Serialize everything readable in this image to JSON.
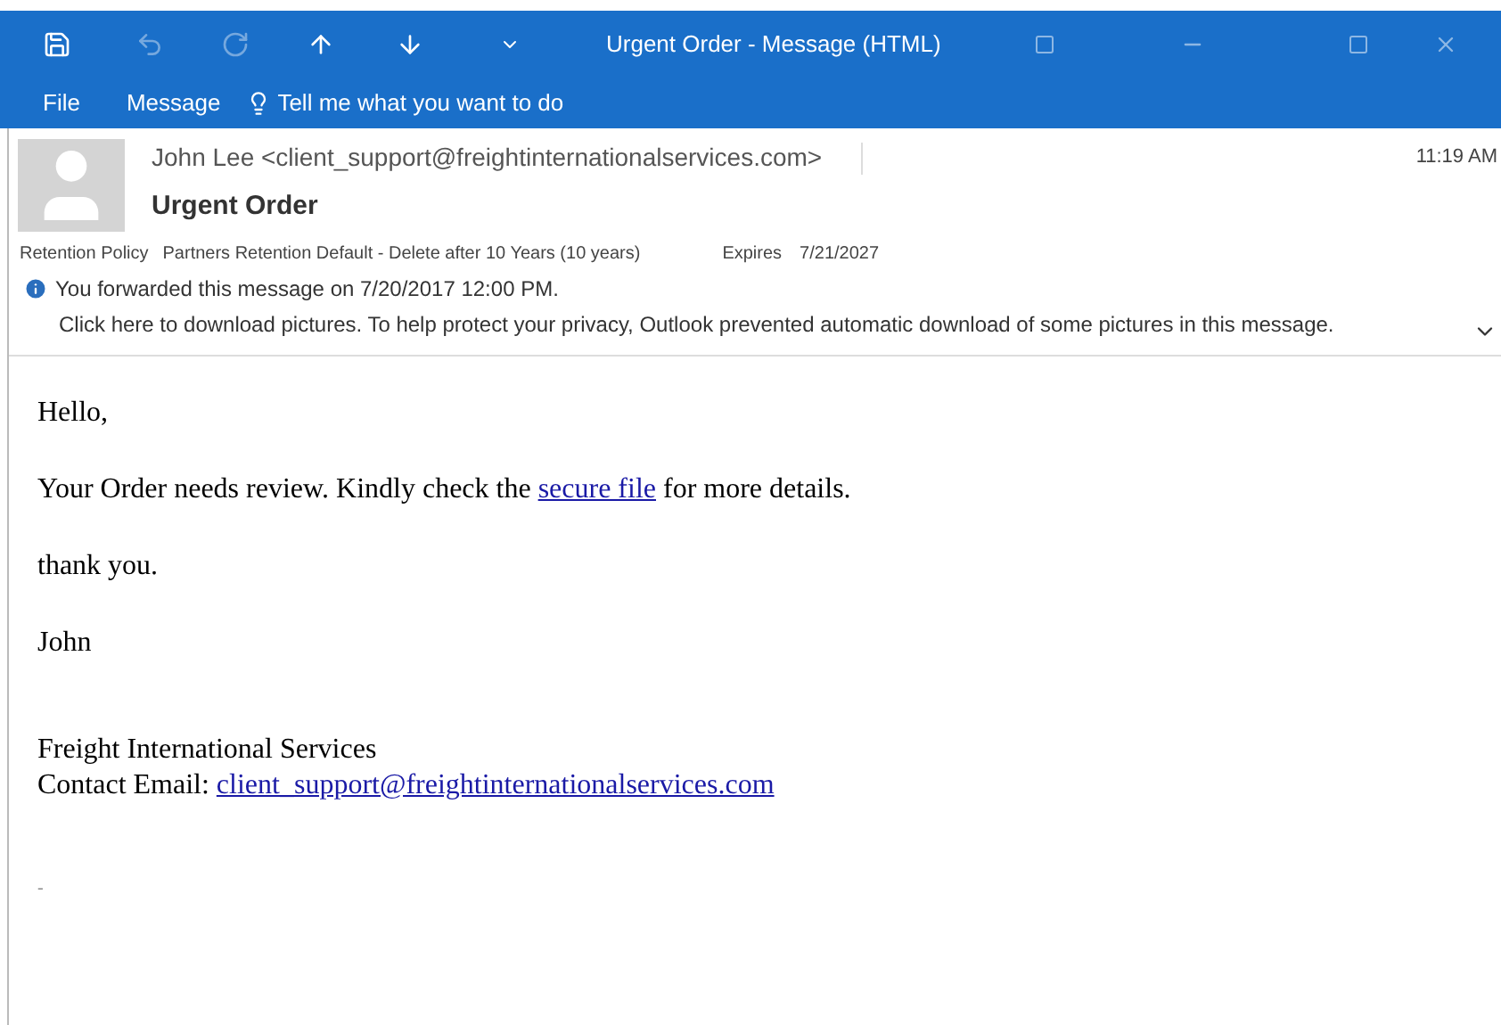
{
  "window": {
    "title": "Urgent Order - Message (HTML)"
  },
  "ribbon_tabs": [
    {
      "label": "File"
    },
    {
      "label": "Message"
    }
  ],
  "tell_me": {
    "placeholder": "Tell me what you want to do"
  },
  "header": {
    "from": "John Lee <client_support@freightinternationalservices.com>",
    "time": "11:19 AM",
    "subject": "Urgent Order",
    "retention_label": "Retention Policy",
    "retention_value": "Partners Retention Default - Delete after 10 Years (10 years)",
    "expires_label": "Expires",
    "expires_value": "7/21/2027",
    "info_lines": [
      "You forwarded this message on 7/20/2017 12:00 PM.",
      "Click here to download pictures. To help protect your privacy, Outlook prevented automatic download of some pictures in this message."
    ]
  },
  "body": {
    "greeting": "Hello,",
    "line_before_link": "Your Order needs review. Kindly check the",
    "link": "secure file",
    "line_after_link": "for more details.",
    "thanks": "thank you.",
    "name": "John",
    "company": "Freight International Services",
    "contact_label": "Contact Email:",
    "contact_email": "client_support@freightinternationalservices.com",
    "trailing_mark": "-"
  }
}
